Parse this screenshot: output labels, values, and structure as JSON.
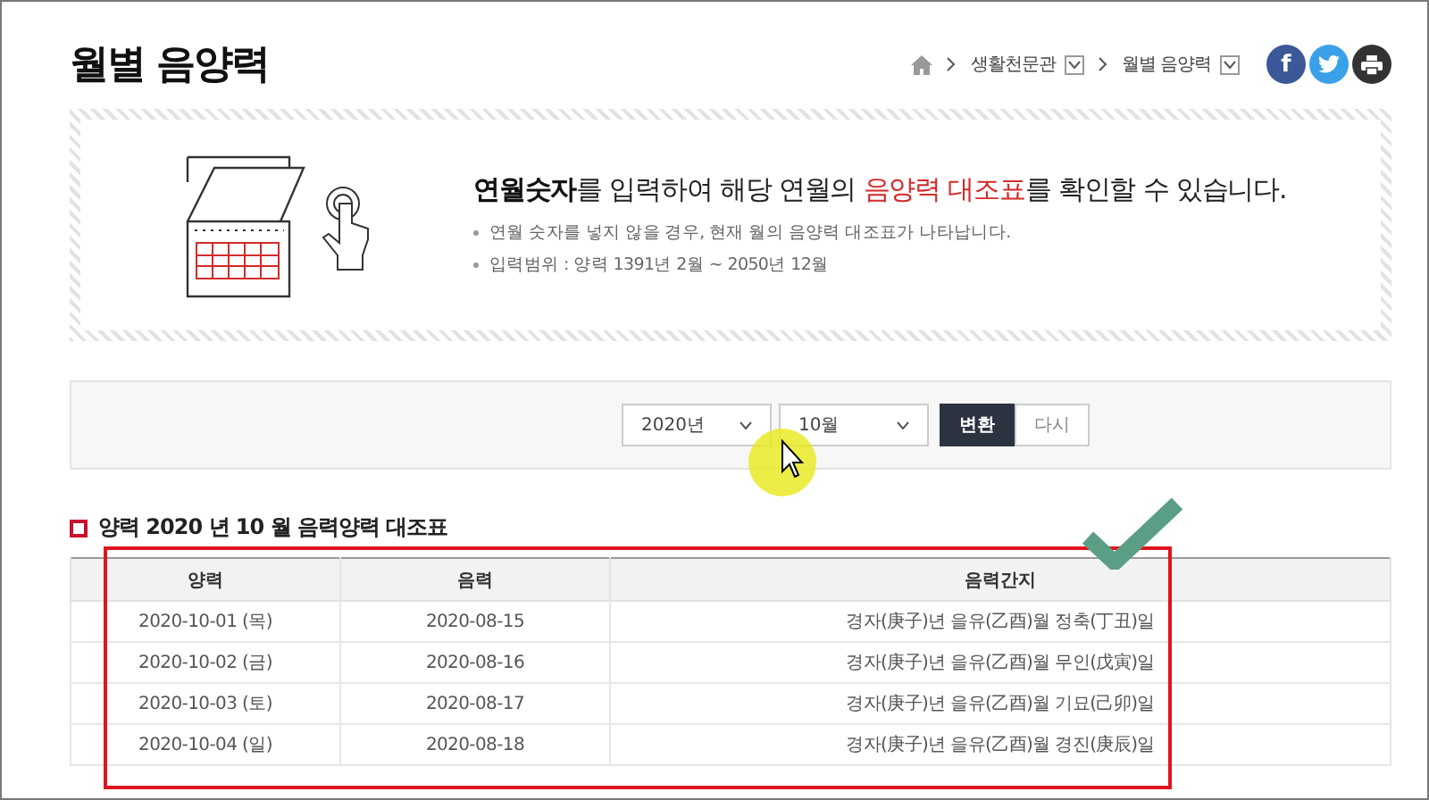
{
  "page_title": "월별 음양력",
  "breadcrumb": [
    {
      "label": "생활천문관"
    },
    {
      "label": "월별 음양력"
    }
  ],
  "share_buttons": [
    {
      "kind": "facebook",
      "label": "f"
    },
    {
      "kind": "twitter"
    },
    {
      "kind": "print"
    }
  ],
  "intro": {
    "headline": [
      {
        "kind": "bold",
        "text": "연월숫자"
      },
      {
        "kind": "plain",
        "text": "를 입력하여 해당 연월의 "
      },
      {
        "kind": "red",
        "text": "음양력 대조표"
      },
      {
        "kind": "plain",
        "text": "를 확인할 수 있습니다."
      }
    ],
    "notes": [
      "연월 숫자를 넣지 않을 경우, 현재 월의 음양력 대조표가 나타납니다.",
      "입력범위 : 양력 1391년 2월 ~ 2050년 12월"
    ]
  },
  "form": {
    "year": "2020년",
    "month": "10월",
    "buttons": [
      {
        "label": "변환",
        "primary": true
      },
      {
        "label": "다시",
        "primary": false
      }
    ]
  },
  "section_title": "양력 2020 년 10 월 음력양력 대조표",
  "table": {
    "columns": [
      "양력",
      "음력",
      "음력간지"
    ],
    "rows": [
      [
        "2020-10-01 (목)",
        "2020-08-15",
        "경자(庚子)년 을유(乙酉)월 정축(丁丑)일"
      ],
      [
        "2020-10-02 (금)",
        "2020-08-16",
        "경자(庚子)년 을유(乙酉)월 무인(戊寅)일"
      ],
      [
        "2020-10-03 (토)",
        "2020-08-17",
        "경자(庚子)년 을유(乙酉)월 기묘(己卯)일"
      ],
      [
        "2020-10-04 (일)",
        "2020-08-18",
        "경자(庚子)년 을유(乙酉)월 경진(庚辰)일"
      ]
    ]
  }
}
